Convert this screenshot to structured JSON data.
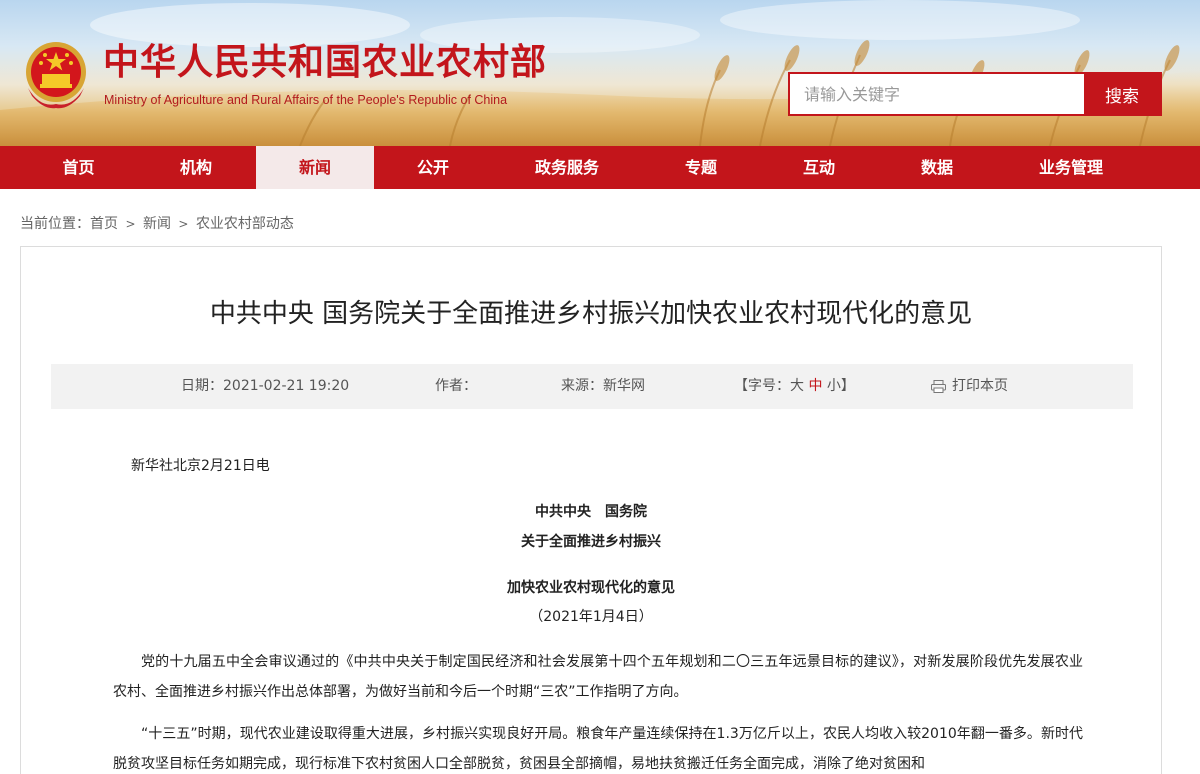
{
  "site": {
    "title": "中华人民共和国农业农村部",
    "subtitle": "Ministry of Agriculture and Rural Affairs of the People's Republic of China",
    "emblem_icon": "national-emblem-icon",
    "brand_color": "#c3151b"
  },
  "search": {
    "placeholder": "请输入关键字",
    "value": "",
    "button_label": "搜索"
  },
  "nav": {
    "items": [
      {
        "label": "首页"
      },
      {
        "label": "机构"
      },
      {
        "label": "新闻",
        "active": true
      },
      {
        "label": "公开"
      },
      {
        "label": "政务服务"
      },
      {
        "label": "专题"
      },
      {
        "label": "互动"
      },
      {
        "label": "数据"
      },
      {
        "label": "业务管理"
      }
    ]
  },
  "breadcrumb": {
    "prefix": "当前位置：",
    "items": [
      "首页",
      "新闻",
      "农业农村部动态"
    ],
    "separator": ">"
  },
  "article": {
    "title": "中共中央 国务院关于全面推进乡村振兴加快农业农村现代化的意见",
    "meta": {
      "date_label": "日期：",
      "date_value": "2021-02-21 19:20",
      "author_label": "作者：",
      "author_value": "",
      "source_label": "来源：",
      "source_value": "新华网",
      "font_size_open": "【字号：",
      "font_size_large": "大",
      "font_size_medium": "中",
      "font_size_small": "小",
      "font_size_close": "】",
      "print_icon": "print-icon",
      "print_label": "打印本页"
    },
    "dateline": "新华社北京2月21日电",
    "heading_line1": "中共中央　国务院",
    "heading_line2": "关于全面推进乡村振兴",
    "heading_line3": "加快农业农村现代化的意见",
    "heading_date": "（2021年1月4日）",
    "paragraphs": [
      "党的十九届五中全会审议通过的《中共中央关于制定国民经济和社会发展第十四个五年规划和二〇三五年远景目标的建议》，对新发展阶段优先发展农业农村、全面推进乡村振兴作出总体部署，为做好当前和今后一个时期“三农”工作指明了方向。",
      "“十三五”时期，现代农业建设取得重大进展，乡村振兴实现良好开局。粮食年产量连续保持在1.3万亿斤以上，农民人均收入较2010年翻一番多。新时代脱贫攻坚目标任务如期完成，现行标准下农村贫困人口全部脱贫，贫困县全部摘帽，易地扶贫搬迁任务全面完成，消除了绝对贫困和"
    ]
  }
}
